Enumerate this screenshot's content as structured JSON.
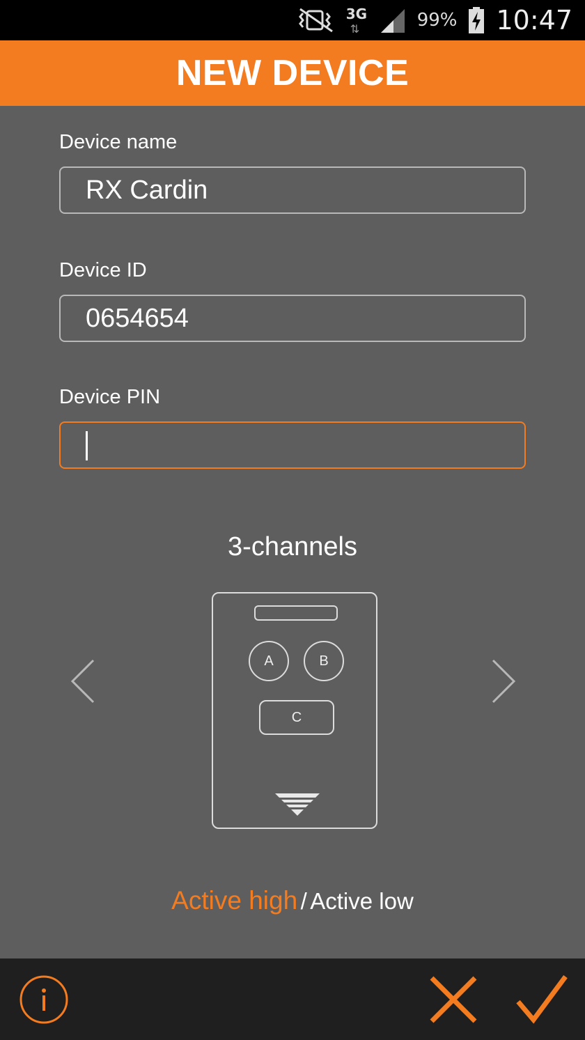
{
  "status_bar": {
    "network_type": "3G",
    "battery": "99%",
    "time": "10:47",
    "icons": [
      "vibrate-icon",
      "network-3g-icon",
      "signal-icon",
      "battery-charging-icon"
    ]
  },
  "header": {
    "title": "NEW DEVICE"
  },
  "form": {
    "device_name": {
      "label": "Device name",
      "value": "RX Cardin"
    },
    "device_id": {
      "label": "Device ID",
      "value": "0654654"
    },
    "device_pin": {
      "label": "Device PIN",
      "value": ""
    }
  },
  "selector": {
    "title": "3-channels",
    "remote": {
      "buttons": [
        "A",
        "B",
        "C"
      ]
    }
  },
  "mode": {
    "active_high": "Active high",
    "separator": "/",
    "active_low": "Active low",
    "selected": "Active high"
  },
  "colors": {
    "accent": "#f47c20",
    "background": "#5e5e5e",
    "bottom_bar": "#1f1f1f",
    "status_bar": "#000000"
  },
  "bottom_bar": {
    "icons": [
      "info-icon",
      "cancel-icon",
      "confirm-icon"
    ]
  }
}
